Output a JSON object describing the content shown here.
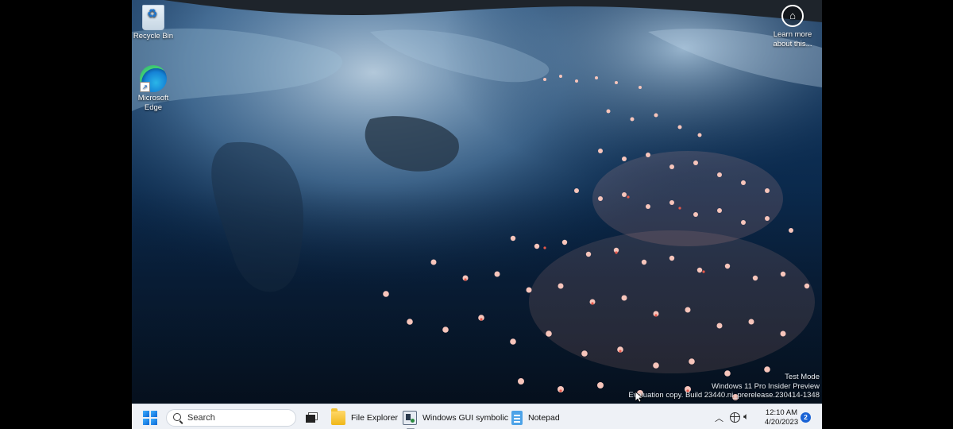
{
  "desktop": {
    "icons": [
      {
        "label_line1": "Recycle Bin",
        "label_line2": "",
        "icon": "recycle-bin-icon"
      },
      {
        "label_line1": "Microsoft",
        "label_line2": "Edge",
        "icon": "edge-icon"
      }
    ],
    "learn_more": {
      "line1": "Learn more",
      "line2": "about this...",
      "icon": "camera-icon"
    },
    "watermark": {
      "line1": "Test Mode",
      "line2": "Windows 11 Pro Insider Preview",
      "line3": "Evaluation copy. Build 23440.ni_prerelease.230414-1348"
    }
  },
  "taskbar": {
    "start_icon": "windows-start-icon",
    "search": {
      "placeholder": "Search"
    },
    "task_view_icon": "task-view-icon",
    "apps": [
      {
        "label": "File Explorer",
        "icon": "folder-icon"
      },
      {
        "label": "Windows GUI symbolic",
        "icon": "debugger-app-icon"
      },
      {
        "label": "Notepad",
        "icon": "notepad-icon"
      }
    ],
    "tray": {
      "overflow_icon": "chevron-up-icon",
      "network_icon": "globe-network-icon",
      "volume_icon": "speaker-icon",
      "time": "12:10 AM",
      "date": "4/20/2023",
      "notification_count": "2"
    }
  },
  "colors": {
    "taskbar_bg": "#eef1f6",
    "wallpaper_water": "#0b2a4d",
    "accent": "#1a63d6",
    "flamingo": "#f2a59a"
  }
}
